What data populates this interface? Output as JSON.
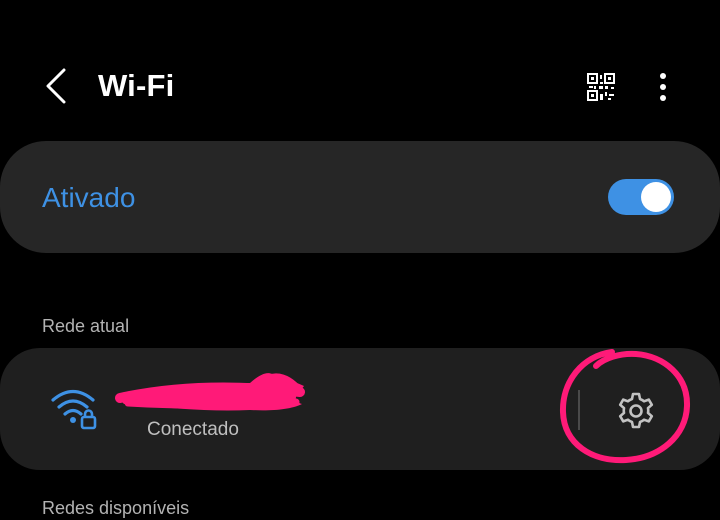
{
  "header": {
    "title": "Wi-Fi",
    "back_icon": "chevron-left-icon",
    "qr_icon": "qr-code-icon",
    "more_icon": "more-vertical-icon"
  },
  "wifi_toggle": {
    "label": "Ativado",
    "enabled": true,
    "accent_color": "#3e91e4"
  },
  "current_network": {
    "section_label": "Rede atual",
    "status": "Conectado",
    "icon": "wifi-locked-icon",
    "settings_icon": "gear-icon"
  },
  "available_networks": {
    "section_label": "Redes disponíveis"
  },
  "annotations": {
    "redaction_color": "#ff1a78",
    "highlight_color": "#ff1a78"
  }
}
